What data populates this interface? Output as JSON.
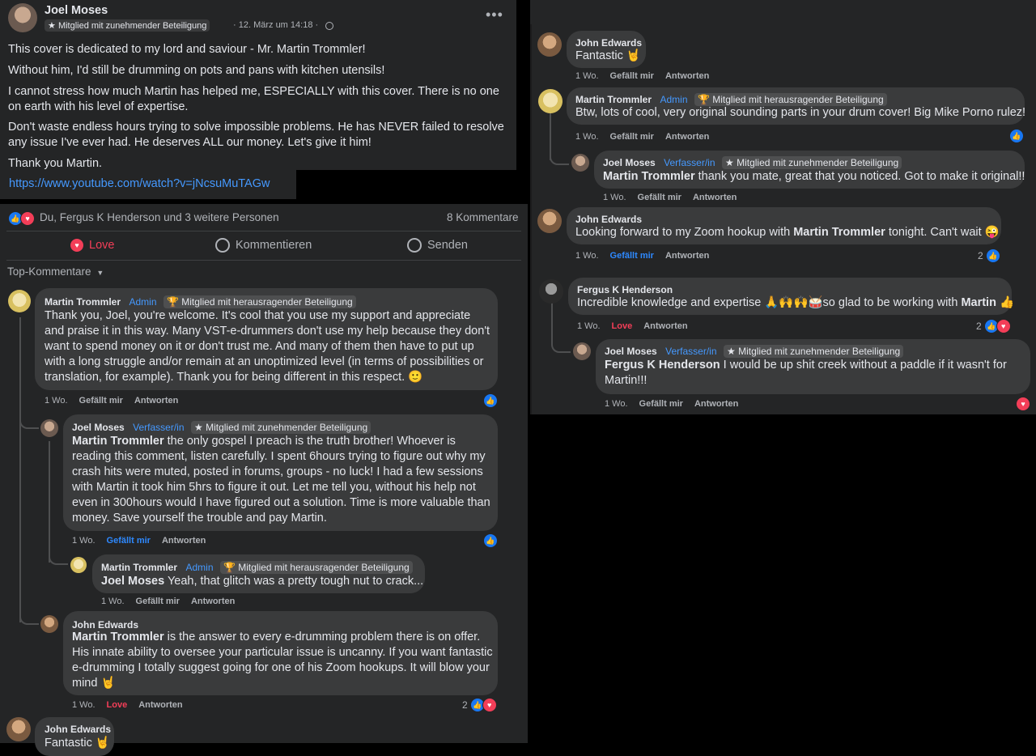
{
  "post": {
    "author": "Joel Moses",
    "badge": "Mitglied mit zunehmender Beteiligung",
    "date": "· 12. März um 14:18 ·",
    "privacy_icon": "globe-icon",
    "paragraphs": [
      "This cover is dedicated to my lord and saviour - Mr. Martin Trommler!",
      "Without him, I'd still be drumming on pots and pans with kitchen utensils!",
      "I cannot stress how much Martin has helped me, ESPECIALLY with this cover. There is no one on earth with his level of expertise.",
      "Don't waste endless hours trying to solve impossible problems. He has NEVER failed to resolve any issue I've ever had. He deserves ALL our money. Let's give it him!",
      "Thank you Martin."
    ],
    "link": "https://www.youtube.com/watch?v=jNcsuMuTAGw",
    "reactions_text": "Du, Fergus K Henderson und 3 weitere Personen",
    "comments_count": "8 Kommentare",
    "actions": {
      "love": "Love",
      "comment": "Kommentieren",
      "send": "Senden"
    },
    "sort_label": "Top-Kommentare"
  },
  "colors": {
    "panel": "#242526",
    "bubble": "#3a3b3c",
    "accent": "#2e89ff",
    "love": "#f33e58"
  },
  "labels": {
    "week": "1 Wo.",
    "like": "Gefällt mir",
    "reply": "Antworten",
    "love": "Love",
    "admin": "Admin",
    "author_role": "Verfasser/in",
    "badge_top": "Mitglied mit herausragender Beteiligung",
    "badge_mid": "Mitglied mit zunehmender Beteiligung"
  },
  "left_comments": {
    "c1": {
      "name": "Martin Trommler",
      "text": "Thank you, Joel, you're welcome. It's cool that you use my support and appreciate and praise it in this way. Many VST-e-drummers don't use my help because they don't want to spend money on it or don't trust me. And many of them then have to put up with a long struggle and/or remain at an unoptimized level (in terms of possibilities or translation, for example). Thank you for being different in this respect. 🙂"
    },
    "c2": {
      "name": "Joel Moses",
      "mention": "Martin Trommler",
      "text": " the only gospel I preach is the truth brother! Whoever is reading this comment, listen carefully. I spent 6hours trying to figure out why my crash hits were muted, posted in forums, groups - no luck! I had a few sessions with Martin it took him 5hrs to figure it out. Let me tell you, without his help not even in 300hours would I have figured out a solution. Time is more valuable than money. Save yourself the trouble and pay Martin."
    },
    "c3": {
      "name": "Martin Trommler",
      "mention": "Joel Moses",
      "text": " Yeah, that glitch was a pretty tough nut to crack..."
    },
    "c4": {
      "name": "John Edwards",
      "mention": "Martin Trommler",
      "text": " is the answer to every e-drumming problem there is on offer. His innate ability to oversee your particular issue is uncanny. If you want fantastic e-drumming I totally suggest going for one of his Zoom hookups. It will blow your mind 🤘",
      "react_count": "2"
    },
    "c5": {
      "name": "John Edwards",
      "text": "Fantastic 🤘"
    }
  },
  "right_comments": {
    "r1": {
      "name": "John Edwards",
      "text": "Fantastic 🤘"
    },
    "r2": {
      "name": "Martin Trommler",
      "text": "Btw, lots of cool, very original sounding parts in your drum cover! Big Mike Porno rulez!"
    },
    "r3": {
      "name": "Joel Moses",
      "mention": "Martin Trommler",
      "text": " thank you mate, great that you noticed. Got to make it original!!"
    },
    "r4": {
      "name": "John Edwards",
      "text_a": "Looking forward to my Zoom hookup with ",
      "mention": "Martin Trommler",
      "text_b": " tonight. Can't wait 😜",
      "react_count": "2"
    },
    "r5": {
      "name": "Fergus K Henderson",
      "text_a": "Incredible knowledge and expertise 🙏🙌🙌🥁so glad to be working with ",
      "mention": "Martin",
      "text_b": " 👍",
      "react_count": "2"
    },
    "r6": {
      "name": "Joel Moses",
      "mention": "Fergus K Henderson",
      "text": " I would be up shit creek without a paddle if it wasn't for Martin!!!"
    }
  }
}
